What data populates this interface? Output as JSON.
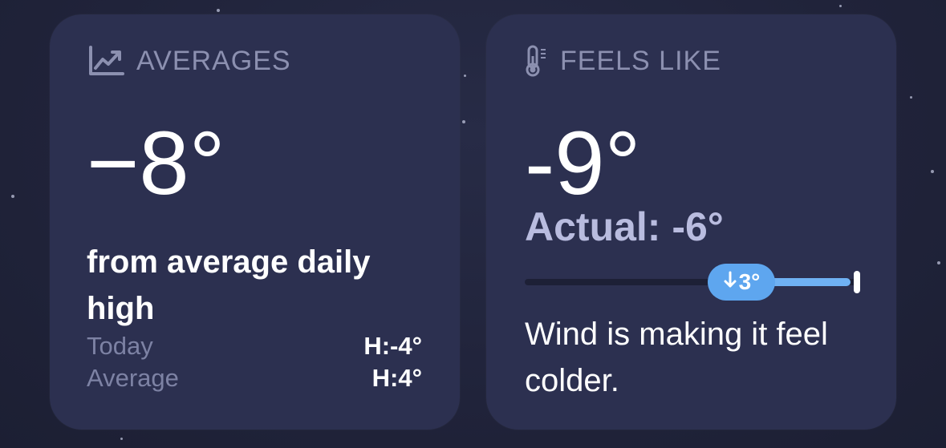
{
  "averages_card": {
    "header": "AVERAGES",
    "icon": "chart-line-icon",
    "value": "−8°",
    "description": "from average daily high",
    "rows": [
      {
        "label": "Today",
        "value": "H:-4°"
      },
      {
        "label": "Average",
        "value": "H:4°"
      }
    ]
  },
  "feels_like_card": {
    "header": "FEELS LIKE",
    "icon": "thermometer-icon",
    "value": "-9°",
    "actual": "Actual: -6°",
    "difference": "3°",
    "difference_icon": "arrow-down-icon",
    "description": "Wind is making it feel colder."
  },
  "colors": {
    "background": "#20233a",
    "card": "#2c3050",
    "muted_text": "#8c90b0",
    "actual_text": "#b9bcdf",
    "accent": "#5ea6ef"
  }
}
